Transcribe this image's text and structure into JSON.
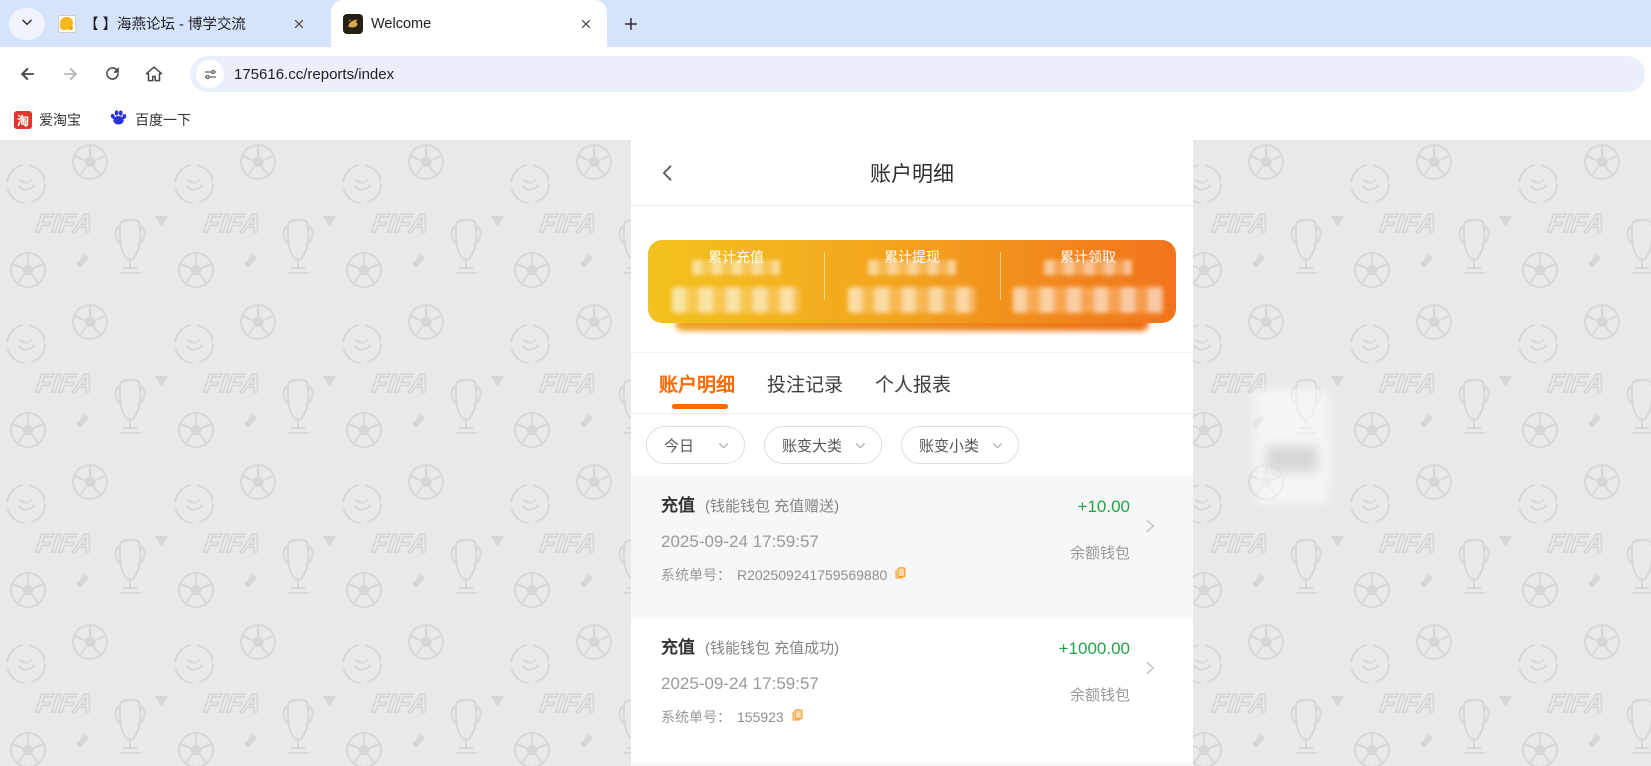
{
  "browser": {
    "tab_search_tooltip": "search-tabs",
    "tabs": [
      {
        "title": "【 】海燕论坛 - 博学交流",
        "active": false
      },
      {
        "title": "Welcome",
        "active": true
      }
    ],
    "url": "175616.cc/reports/index",
    "bookmarks": [
      {
        "label": "爱淘宝",
        "icon_glyph": "淘"
      },
      {
        "label": "百度一下"
      }
    ]
  },
  "page": {
    "header": {
      "title": "账户明细"
    },
    "summary_card": {
      "stats": [
        {
          "label": "累计充值",
          "value_redacted": true
        },
        {
          "label": "累计提现",
          "value_redacted": true
        },
        {
          "label": "累计领取",
          "value_redacted": true
        }
      ]
    },
    "tabs": [
      {
        "label": "账户明细",
        "active": true
      },
      {
        "label": "投注记录",
        "active": false
      },
      {
        "label": "个人报表",
        "active": false
      }
    ],
    "filters": [
      {
        "label": "今日"
      },
      {
        "label": "账变大类"
      },
      {
        "label": "账变小类"
      }
    ],
    "transactions": [
      {
        "type": "充值",
        "detail": "(钱能钱包 充值赠送)",
        "time": "2025-09-24 17:59:57",
        "order_label": "系统单号：",
        "order_no": "R202509241759569880",
        "amount": "+10.00",
        "wallet": "余额钱包"
      },
      {
        "type": "充值",
        "detail": "(钱能钱包 充值成功)",
        "time": "2025-09-24 17:59:57",
        "order_label": "系统单号：",
        "order_no": "155923",
        "amount": "+1000.00",
        "wallet": "余额钱包"
      }
    ],
    "colors": {
      "accent_orange": "#fe6a00",
      "amount_green": "#21a447",
      "card_gradient_start": "#f3c21e",
      "card_gradient_end": "#f1731c"
    }
  }
}
